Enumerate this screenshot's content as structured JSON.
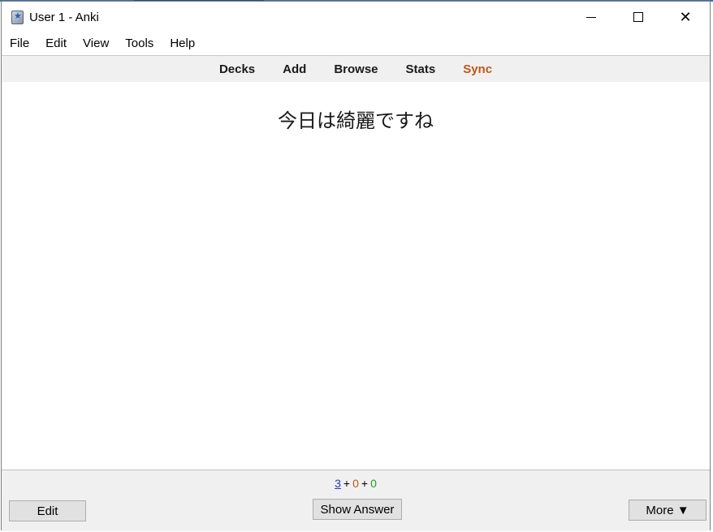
{
  "window": {
    "title": "User 1 - Anki",
    "controls": {
      "minimize": "minimize",
      "maximize": "maximize",
      "close": "✕"
    }
  },
  "menu": {
    "items": [
      {
        "label": "File"
      },
      {
        "label": "Edit"
      },
      {
        "label": "View"
      },
      {
        "label": "Tools"
      },
      {
        "label": "Help"
      }
    ]
  },
  "toolbar": {
    "decks": "Decks",
    "add": "Add",
    "browse": "Browse",
    "stats": "Stats",
    "sync": "Sync",
    "sync_color": "#c35617"
  },
  "card": {
    "question": "今日は綺麗ですね"
  },
  "counts": {
    "new": "3",
    "learning": "0",
    "review": "0",
    "separator": "+",
    "new_color": "#1f3bbf",
    "learning_color": "#c35617",
    "review_color": "#22a022"
  },
  "bottom": {
    "edit_label": "Edit",
    "show_answer_label": "Show Answer",
    "more_label": "More ▼"
  }
}
